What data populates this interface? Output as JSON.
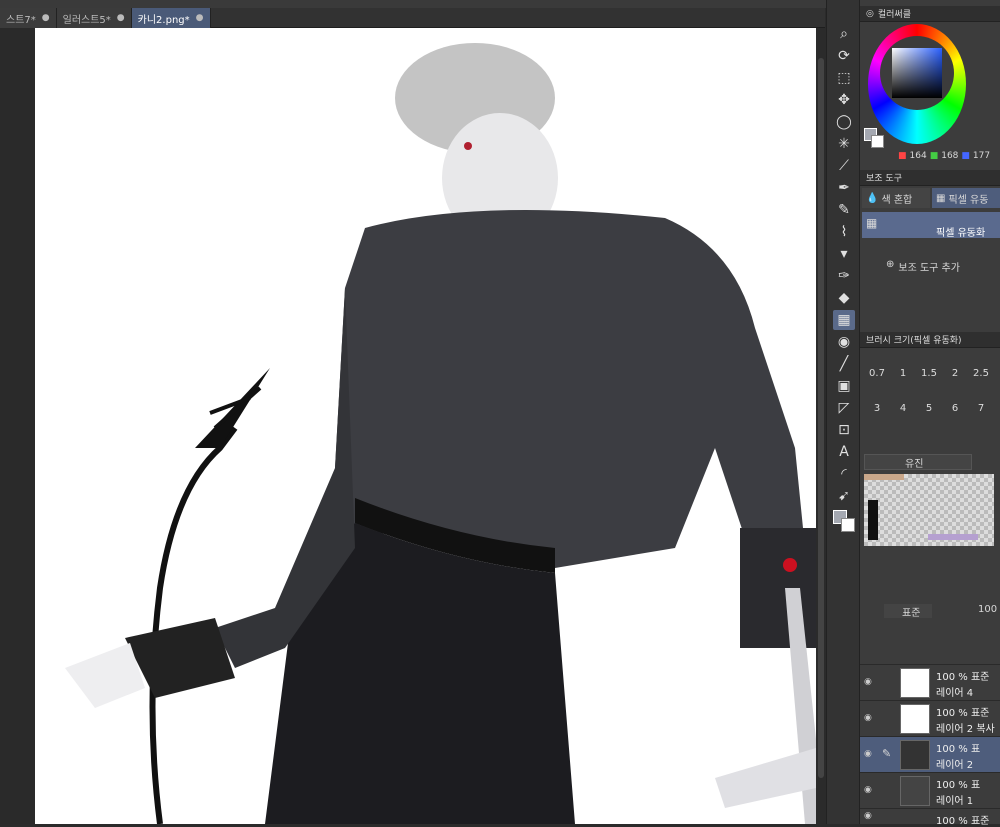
{
  "tabs": [
    {
      "label": "스트7*",
      "close": "●"
    },
    {
      "label": "일러스트5*",
      "close": "●"
    },
    {
      "label": "카니2.png*",
      "close": "●"
    }
  ],
  "color_panel": {
    "title": "컬러써클",
    "rgb": {
      "r": "164",
      "g": "168",
      "b": "177"
    },
    "main_color": "#a4a8b1"
  },
  "subtool_panel": {
    "title": "보조 도구",
    "tab_mix": "색 혼합",
    "tab_liquify": "픽셀 유동",
    "selected_tool": "픽셀 유동화",
    "add_button": "보조 도구 추가"
  },
  "brush_size_panel": {
    "title": "브러시 크기(픽셀 유동화)",
    "sizes_row1": [
      "0.7",
      "1",
      "1.5",
      "2",
      "2.5"
    ],
    "sizes_row2": [
      "3",
      "4",
      "5",
      "6",
      "7"
    ]
  },
  "material_panel": {
    "dropdown": "유진"
  },
  "layer_panel": {
    "blend_mode": "표준",
    "opacity": "100",
    "layers": [
      {
        "opacity": "100 %",
        "mode": "표준",
        "name": "레이어 4"
      },
      {
        "opacity": "100 %",
        "mode": "표준",
        "name": "레이어 2 복사"
      },
      {
        "opacity": "100 %",
        "mode": "표",
        "name": "레이어 2"
      },
      {
        "opacity": "100 %",
        "mode": "표",
        "name": "레이어 1"
      },
      {
        "opacity": "100 %",
        "mode": "표준",
        "name": ""
      }
    ]
  }
}
